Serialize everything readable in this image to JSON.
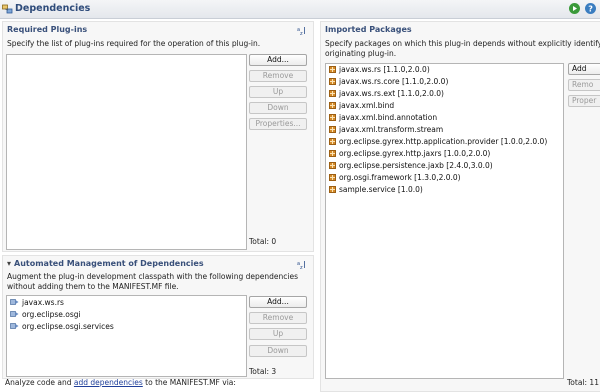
{
  "header": {
    "title": "Dependencies"
  },
  "required": {
    "title": "Required Plug-ins",
    "description": "Specify the list of plug-ins required for the operation of this plug-in.",
    "buttons": {
      "add": "Add...",
      "remove": "Remove",
      "up": "Up",
      "down": "Down",
      "properties": "Properties..."
    },
    "total": "Total: 0"
  },
  "imported": {
    "title": "Imported Packages",
    "description_line1": "Specify packages on which this plug-in depends without explicitly identifying",
    "description_line2": "originating plug-in.",
    "items": [
      "javax.ws.rs [1.1.0,2.0.0)",
      "javax.ws.rs.core [1.1.0,2.0.0)",
      "javax.ws.rs.ext [1.1.0,2.0.0)",
      "javax.xml.bind",
      "javax.xml.bind.annotation",
      "javax.xml.transform.stream",
      "org.eclipse.gyrex.http.application.provider [1.0.0,2.0.0)",
      "org.eclipse.gyrex.http.jaxrs [1.0.0,2.0.0)",
      "org.eclipse.persistence.jaxb [2.4.0,3.0.0)",
      "org.osgi.framework [1.3.0,2.0.0)",
      "sample.service [1.0.0)"
    ],
    "buttons": {
      "add": "Add",
      "remove": "Remo",
      "properties": "Proper"
    },
    "total": "Total: 11"
  },
  "automated": {
    "title": "Automated Management of Dependencies",
    "description_line1": "Augment the plug-in development classpath with the following dependencies",
    "description_line2": "without adding them to the MANIFEST.MF file.",
    "items": [
      "javax.ws.rs",
      "org.eclipse.osgi",
      "org.eclipse.osgi.services"
    ],
    "buttons": {
      "add": "Add...",
      "remove": "Remove",
      "up": "Up",
      "down": "Down"
    },
    "total": "Total: 3"
  },
  "analyze": {
    "prefix": "Analyze code and ",
    "link": "add dependencies",
    "suffix": " to the MANIFEST.MF via:"
  }
}
